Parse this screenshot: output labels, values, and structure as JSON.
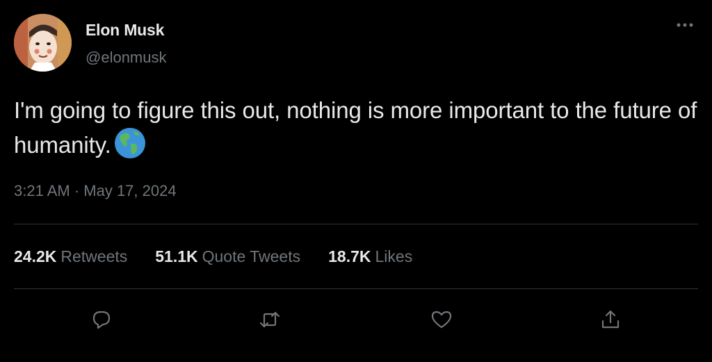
{
  "author": {
    "display_name": "Elon Musk",
    "handle": "@elonmusk",
    "avatar_icon": "avatar-portrait"
  },
  "tweet": {
    "text": "I'm going to figure this out, nothing is more important to the future of humanity.",
    "emoji_icon": "globe-americas-icon",
    "timestamp": "3:21 AM · May 17, 2024"
  },
  "stats": {
    "retweets": {
      "count": "24.2K",
      "label": "Retweets"
    },
    "quotes": {
      "count": "51.1K",
      "label": "Quote Tweets"
    },
    "likes": {
      "count": "18.7K",
      "label": "Likes"
    }
  },
  "actions": [
    "reply-icon",
    "retweet-icon",
    "like-icon",
    "share-icon"
  ],
  "colors": {
    "background": "#000000",
    "primary_text": "#e7e9ea",
    "secondary_text": "#71767b",
    "divider": "#2f3336"
  }
}
